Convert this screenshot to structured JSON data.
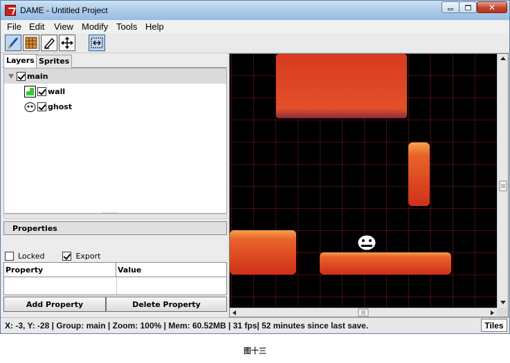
{
  "window": {
    "title": "DAME - Untitled Project"
  },
  "menu": {
    "items": [
      "File",
      "Edit",
      "View",
      "Modify",
      "Tools",
      "Help"
    ]
  },
  "toolbar": {
    "tools": [
      "paintbrush-icon",
      "tile-grid-icon",
      "eraser-icon",
      "move-icon",
      "select-region-icon"
    ]
  },
  "left_panel": {
    "tabs": [
      "Layers",
      "Sprites"
    ],
    "layers": [
      {
        "name": "main",
        "checked": true,
        "type": "group"
      },
      {
        "name": "wall",
        "checked": true,
        "type": "tilemap"
      },
      {
        "name": "ghost",
        "checked": true,
        "type": "sprite"
      }
    ],
    "properties_title": "Properties",
    "locked_label": "Locked",
    "export_label": "Export",
    "locked_checked": false,
    "export_checked": true,
    "table_headers": [
      "Property",
      "Value"
    ],
    "add_button": "Add Property",
    "delete_button": "Delete Property"
  },
  "colors": {
    "grid": "#8b1a1a",
    "tile_top": "#f08a3a",
    "tile_body": "#d8331c"
  },
  "status": {
    "text": "X: -3, Y: -28 | Group: main | Zoom: 100% | Mem: 60.52MB | 31 fps| 52 minutes since last save.",
    "tiles_button": "Tiles"
  },
  "caption": "图十三"
}
